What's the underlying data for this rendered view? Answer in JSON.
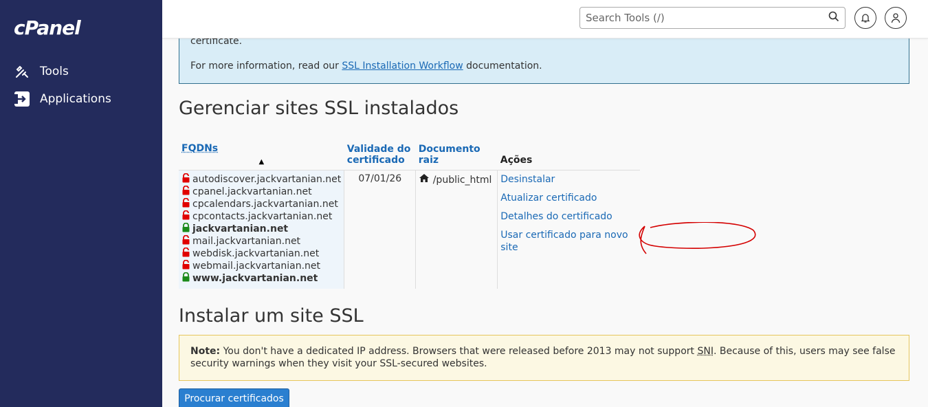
{
  "sidebar": {
    "logo": "cPanel",
    "items": [
      {
        "label": "Tools",
        "icon": "tools-icon"
      },
      {
        "label": "Applications",
        "icon": "applications-icon"
      }
    ]
  },
  "header": {
    "search_placeholder": "Search Tools (/)"
  },
  "info": {
    "line1": "certificate.",
    "line2_prefix": "For more information, read our ",
    "line2_link": "SSL Installation Workflow",
    "line2_suffix": " documentation."
  },
  "manage": {
    "title": "Gerenciar sites SSL instalados",
    "columns": {
      "fqdns": "FQDNs",
      "validity": "Validade do certificado",
      "docroot": "Documento raiz",
      "actions": "Ações"
    },
    "fqdns": [
      {
        "name": "autodiscover.jackvartanian.net",
        "secure": false
      },
      {
        "name": "cpanel.jackvartanian.net",
        "secure": false
      },
      {
        "name": "cpcalendars.jackvartanian.net",
        "secure": false
      },
      {
        "name": "cpcontacts.jackvartanian.net",
        "secure": false
      },
      {
        "name": "jackvartanian.net",
        "secure": true
      },
      {
        "name": "mail.jackvartanian.net",
        "secure": false
      },
      {
        "name": "webdisk.jackvartanian.net",
        "secure": false
      },
      {
        "name": "webmail.jackvartanian.net",
        "secure": false
      },
      {
        "name": "www.jackvartanian.net",
        "secure": true
      }
    ],
    "validity": "07/01/26",
    "docroot": "/public_html",
    "actions": [
      "Desinstalar",
      "Atualizar certificado",
      "Detalhes do certificado",
      "Usar certificado para novo site"
    ]
  },
  "install": {
    "title": "Instalar um site SSL",
    "note_label": "Note:",
    "note_text_a": " You don't have a dedicated IP address. Browsers that were released before 2013 may not support ",
    "note_sni": "SNI",
    "note_text_b": ". Because of this, users may see false security warnings when they visit your SSL-secured websites.",
    "browse_button": "Procurar certificados"
  },
  "colors": {
    "sidebar_bg": "#232b5c",
    "link": "#1a69b5",
    "lock_insecure": "#e00000",
    "lock_secure": "#1a8a1a",
    "annotation": "#d40000"
  }
}
